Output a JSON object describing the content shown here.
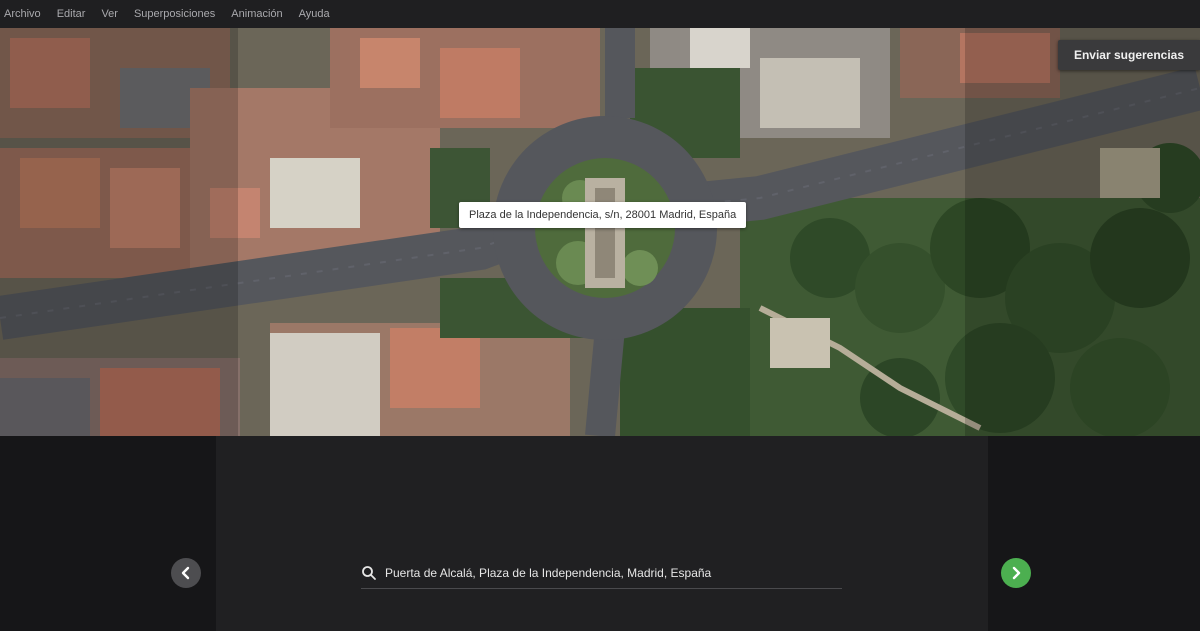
{
  "menu": {
    "items": [
      "Archivo",
      "Editar",
      "Ver",
      "Superposiciones",
      "Animación",
      "Ayuda"
    ]
  },
  "map": {
    "feedback_label": "Enviar sugerencias",
    "tooltip": "Plaza de la Independencia, s/n, 28001 Madrid, España"
  },
  "bottom": {
    "search_value": "Puerta de Alcalá, Plaza de la Independencia, Madrid, España"
  },
  "icons": {
    "prev": "chevron-left-icon",
    "next": "chevron-right-icon",
    "search": "search-icon"
  },
  "colors": {
    "next_button": "#4caf50",
    "prev_button": "#4d4d50",
    "menubar": "#1f1f21"
  }
}
